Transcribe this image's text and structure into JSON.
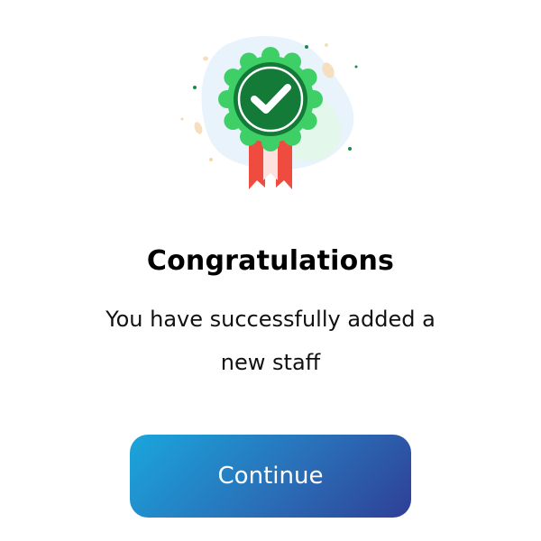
{
  "dialog": {
    "title": "Congratulations",
    "message": "You have successfully added a new staff",
    "continue_label": "Continue"
  },
  "illustration": {
    "icon": "award-badge-checkmark-icon",
    "colors": {
      "badge_outer": "#3ed066",
      "badge_inner": "#14803a",
      "ribbon": "#ef4b3f",
      "blob": "#e6f3fb"
    }
  },
  "colors": {
    "button_gradient_start": "#1aa6dc",
    "button_gradient_end": "#2f3f96",
    "title": "#000000",
    "text": "#111111"
  }
}
